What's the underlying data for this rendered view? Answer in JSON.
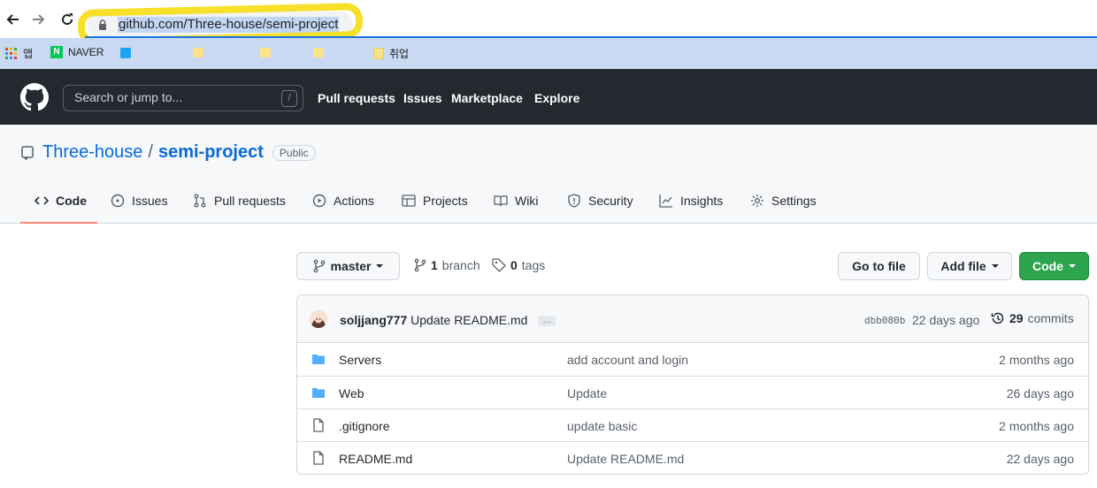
{
  "browser": {
    "url": "github.com/Three-house/semi-project",
    "bookmarks": [
      "앱",
      "NAVER",
      "취업"
    ]
  },
  "header": {
    "search_placeholder": "Search or jump to...",
    "search_shortcut": "/",
    "nav": [
      "Pull requests",
      "Issues",
      "Marketplace",
      "Explore"
    ]
  },
  "repo": {
    "owner": "Three-house",
    "separator": "/",
    "name": "semi-project",
    "visibility": "Public",
    "tabs": [
      "Code",
      "Issues",
      "Pull requests",
      "Actions",
      "Projects",
      "Wiki",
      "Security",
      "Insights",
      "Settings"
    ]
  },
  "toolbar": {
    "branch": "master",
    "branch_count": "1",
    "branch_label": "branch",
    "tag_count": "0",
    "tag_label": "tags",
    "go_to_file": "Go to file",
    "add_file": "Add file",
    "code": "Code"
  },
  "latest_commit": {
    "author": "soljjang777",
    "message": "Update README.md",
    "ellipsis": "…",
    "sha": "dbb080b",
    "age": "22 days ago",
    "count": "29",
    "count_label": "commits"
  },
  "files": [
    {
      "type": "dir",
      "name": "Servers",
      "message": "add account and login",
      "age": "2 months ago"
    },
    {
      "type": "dir",
      "name": "Web",
      "message": "Update",
      "age": "26 days ago"
    },
    {
      "type": "file",
      "name": ".gitignore",
      "message": "update basic",
      "age": "2 months ago"
    },
    {
      "type": "file",
      "name": "README.md",
      "message": "Update README.md",
      "age": "22 days ago"
    }
  ],
  "colors": {
    "header_bg": "#24292f",
    "link_blue": "#0969da",
    "green_button": "#2da44e",
    "tab_underline": "#fd8c73",
    "annotation_yellow": "#f7e02a"
  }
}
